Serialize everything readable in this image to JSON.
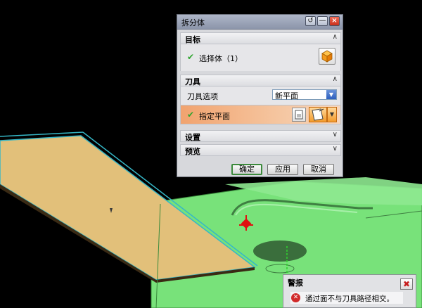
{
  "dialog": {
    "title": "拆分体",
    "sections": {
      "target": {
        "label": "目标",
        "chevron": "∧",
        "row_label": "选择体（1）"
      },
      "tool": {
        "label": "刀具",
        "chevron": "∧",
        "option_label": "刀具选项",
        "option_value": "新平面",
        "plane_label": "指定平面"
      },
      "settings": {
        "label": "设置",
        "chevron": "∨"
      },
      "preview": {
        "label": "预览",
        "chevron": "∨"
      }
    },
    "buttons": {
      "ok": "确定",
      "apply": "应用",
      "cancel": "取消"
    }
  },
  "warning": {
    "title": "警报",
    "message": "通过面不与刀具路径相交。"
  },
  "icons": [
    "reset-icon",
    "minimize-icon",
    "close-icon",
    "check-icon",
    "body-select-icon",
    "plane-dialog-icon",
    "plane-select-icon",
    "dropdown-arrow-icon",
    "error-icon"
  ],
  "colors": {
    "viewport_background": "#000000",
    "solid_body": "#78e27a",
    "plane_fill": "#e2c07a",
    "plane_edge": "#35b7c7",
    "active_row": "#f3b07e",
    "check": "#2ea52e",
    "error": "#d12a2a"
  }
}
